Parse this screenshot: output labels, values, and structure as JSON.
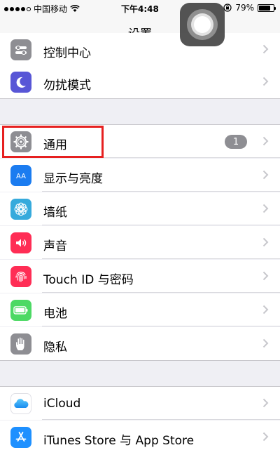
{
  "status_bar": {
    "carrier": "中国移动",
    "time": "下午4:48",
    "battery": "79%",
    "battery_level": 0.79
  },
  "navbar": {
    "title": "设置"
  },
  "rows": [
    {
      "label": "控制中心",
      "icon": "control-center-icon",
      "color": "#8e8e93"
    },
    {
      "label": "勿扰模式",
      "icon": "moon-icon",
      "color": "#5856d6"
    },
    {
      "label": "通用",
      "icon": "gear-icon",
      "color": "#8e8e93",
      "badge": "1"
    },
    {
      "label": "显示与亮度",
      "icon": "text-size-icon",
      "color": "#1b7cf0",
      "glyph": "AA"
    },
    {
      "label": "墙纸",
      "icon": "flower-icon",
      "color": "#36aadc"
    },
    {
      "label": "声音",
      "icon": "speaker-icon",
      "color": "#ff2d55"
    },
    {
      "label": "Touch ID 与密码",
      "icon": "fingerprint-icon",
      "color": "#ff2d55"
    },
    {
      "label": "电池",
      "icon": "battery-icon",
      "color": "#4cd964"
    },
    {
      "label": "隐私",
      "icon": "hand-icon",
      "color": "#8e8e93"
    },
    {
      "label": "iCloud",
      "icon": "cloud-icon",
      "color": "#ffffff"
    },
    {
      "label": "iTunes Store 与 App Store",
      "icon": "app-store-icon",
      "color": "#1e90ff"
    }
  ]
}
